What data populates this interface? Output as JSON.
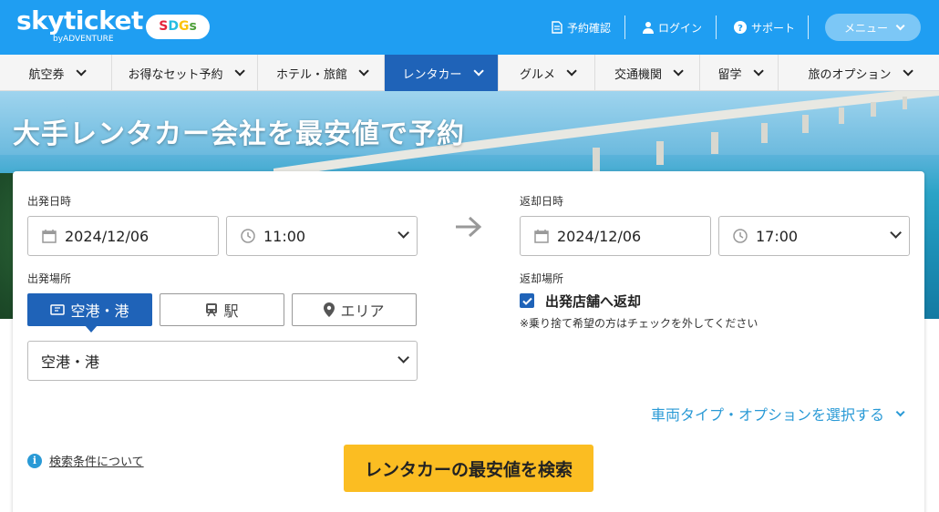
{
  "header": {
    "logo": "skyticket",
    "logo_sub": "byADVENTURE",
    "sdgs": [
      "S",
      "D",
      "G",
      "s"
    ],
    "links": [
      {
        "label": "予約確認",
        "icon": "document-icon"
      },
      {
        "label": "ログイン",
        "icon": "user-icon"
      },
      {
        "label": "サポート",
        "icon": "help-icon"
      }
    ],
    "menu_label": "メニュー"
  },
  "nav": {
    "items": [
      {
        "label": "航空券"
      },
      {
        "label": "お得なセット予約"
      },
      {
        "label": "ホテル・旅館"
      },
      {
        "label": "レンタカー",
        "active": true
      },
      {
        "label": "グルメ"
      },
      {
        "label": "交通機関"
      },
      {
        "label": "留学"
      },
      {
        "label": "旅のオプション"
      }
    ]
  },
  "hero": {
    "title": "大手レンタカー会社を最安値で予約"
  },
  "search": {
    "departure_label": "出発日時",
    "departure_date": "2024/12/06",
    "departure_time": "11:00",
    "return_label": "返却日時",
    "return_date": "2024/12/06",
    "return_time": "17:00",
    "place_label": "出発場所",
    "place_tabs": [
      {
        "label": "空港・港",
        "icon": "ticket-icon",
        "active": true
      },
      {
        "label": "駅",
        "icon": "train-icon"
      },
      {
        "label": "エリア",
        "icon": "location-pin-icon"
      }
    ],
    "place_select": "空港・港",
    "return_place_label": "返却場所",
    "return_same_label": "出発店舗へ返却",
    "return_same_checked": true,
    "return_note": "※乗り捨て希望の方はチェックを外してください",
    "vehicle_link": "車両タイプ・オプションを選択する",
    "info_link": "検索条件について",
    "search_button": "レンタカーの最安値を検索"
  },
  "colors": {
    "header_bg": "#1f9ef2",
    "nav_active": "#1f63b8",
    "search_button": "#fbbd22",
    "link": "#2a9ad6"
  }
}
